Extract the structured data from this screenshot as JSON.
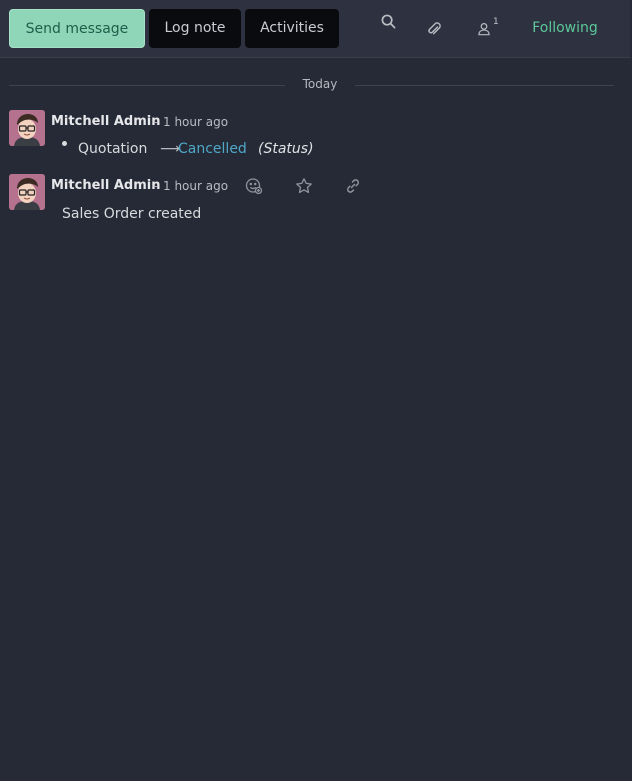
{
  "toolbar": {
    "send_message": "Send message",
    "log_note": "Log note",
    "activities": "Activities",
    "followers_count": "1",
    "following": "Following",
    "icons": [
      "search-icon",
      "paperclip-icon",
      "user-icon"
    ]
  },
  "thread": {
    "date_separator": "Today",
    "messages": [
      {
        "author": "Mitchell Admin",
        "dash": "-",
        "time": "1 hour ago",
        "tracking": {
          "old_value": "Quotation",
          "arrow": "⟶",
          "new_value": "Cancelled",
          "field": "(Status)"
        }
      },
      {
        "author": "Mitchell Admin",
        "dash": "-",
        "time": "1 hour ago",
        "body": "Sales Order created",
        "actions": [
          "add-reaction-icon",
          "star-icon",
          "link-icon"
        ]
      }
    ]
  },
  "colors": {
    "background": "#262a36",
    "topbar": "#2e3240",
    "send_button": "#8fd6b8",
    "following": "#5cc79a",
    "tracking_new_value": "#4fa8c8"
  }
}
